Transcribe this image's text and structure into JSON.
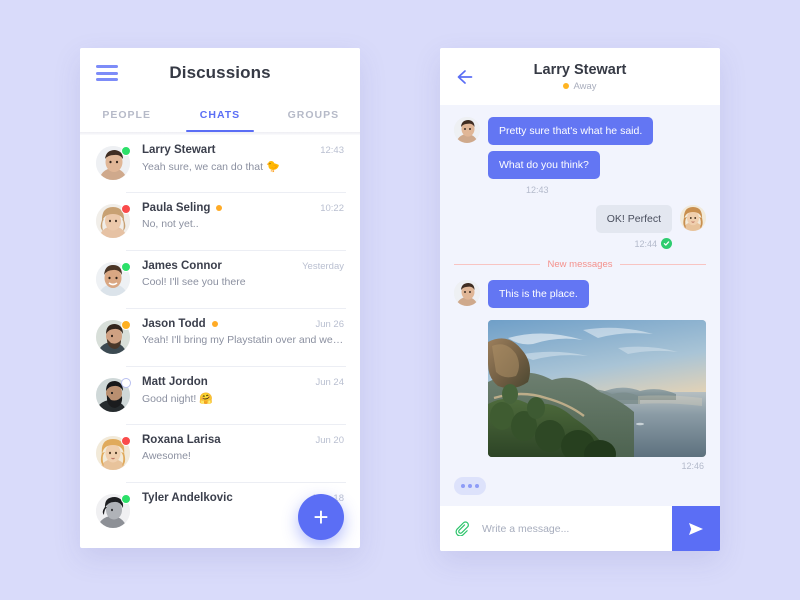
{
  "theme": {
    "page_bg": "#d9dbfa",
    "accent": "#5b6ef5",
    "bubble_in": "#6376f3",
    "bubble_out": "#e3e7f0",
    "thread_bg": "#f2f4fd",
    "new_messages": "#f4918c",
    "online": "#2ce069",
    "busy": "#fa4b4b",
    "away": "#ffb020"
  },
  "left": {
    "menu_icon": "hamburger-icon",
    "title": "Discussions",
    "tabs": [
      {
        "label": "PEOPLE",
        "active": false
      },
      {
        "label": "CHATS",
        "active": true
      },
      {
        "label": "GROUPS",
        "active": false
      }
    ],
    "fab_label": "+",
    "fab_icon": "plus-icon",
    "chats": [
      {
        "name": "Larry Stewart",
        "preview": "Yeah sure, we can do that ",
        "emoji": "🐤",
        "time": "12:43",
        "presence": "online",
        "mini_dot": false
      },
      {
        "name": "Paula Seling",
        "preview": "No, not yet..",
        "emoji": "",
        "time": "10:22",
        "presence": "busy",
        "mini_dot": true
      },
      {
        "name": "James Connor",
        "preview": "Cool! I'll see you there",
        "emoji": "",
        "time": "Yesterday",
        "presence": "online",
        "mini_dot": false
      },
      {
        "name": "Jason Todd",
        "preview": "Yeah! I'll bring my Playstatin over and we can...",
        "emoji": "",
        "time": "Jun 26",
        "presence": "away",
        "mini_dot": true
      },
      {
        "name": "Matt Jordon",
        "preview": "Good night! ",
        "emoji": "🤗",
        "time": "Jun 24",
        "presence": "offline",
        "mini_dot": false
      },
      {
        "name": "Roxana Larisa",
        "preview": "Awesome!",
        "emoji": "",
        "time": "Jun 20",
        "presence": "busy",
        "mini_dot": false
      },
      {
        "name": "Tyler Andelkovic",
        "preview": "",
        "emoji": "",
        "time": "May 18",
        "presence": "online",
        "mini_dot": false
      }
    ]
  },
  "right": {
    "back_icon": "back-arrow-icon",
    "contact_name": "Larry Stewart",
    "status": "Away",
    "messages": {
      "in_1": "Pretty sure that's what he said.",
      "in_2": "What do you think?",
      "in_time": "12:43",
      "out_1": "OK! Perfect",
      "out_time": "12:44",
      "divider": "New messages",
      "in_3": "This is the place.",
      "photo_time": "12:46"
    },
    "composer": {
      "attach_icon": "paperclip-icon",
      "placeholder": "Write a message...",
      "value": "",
      "send_icon": "send-icon"
    }
  }
}
